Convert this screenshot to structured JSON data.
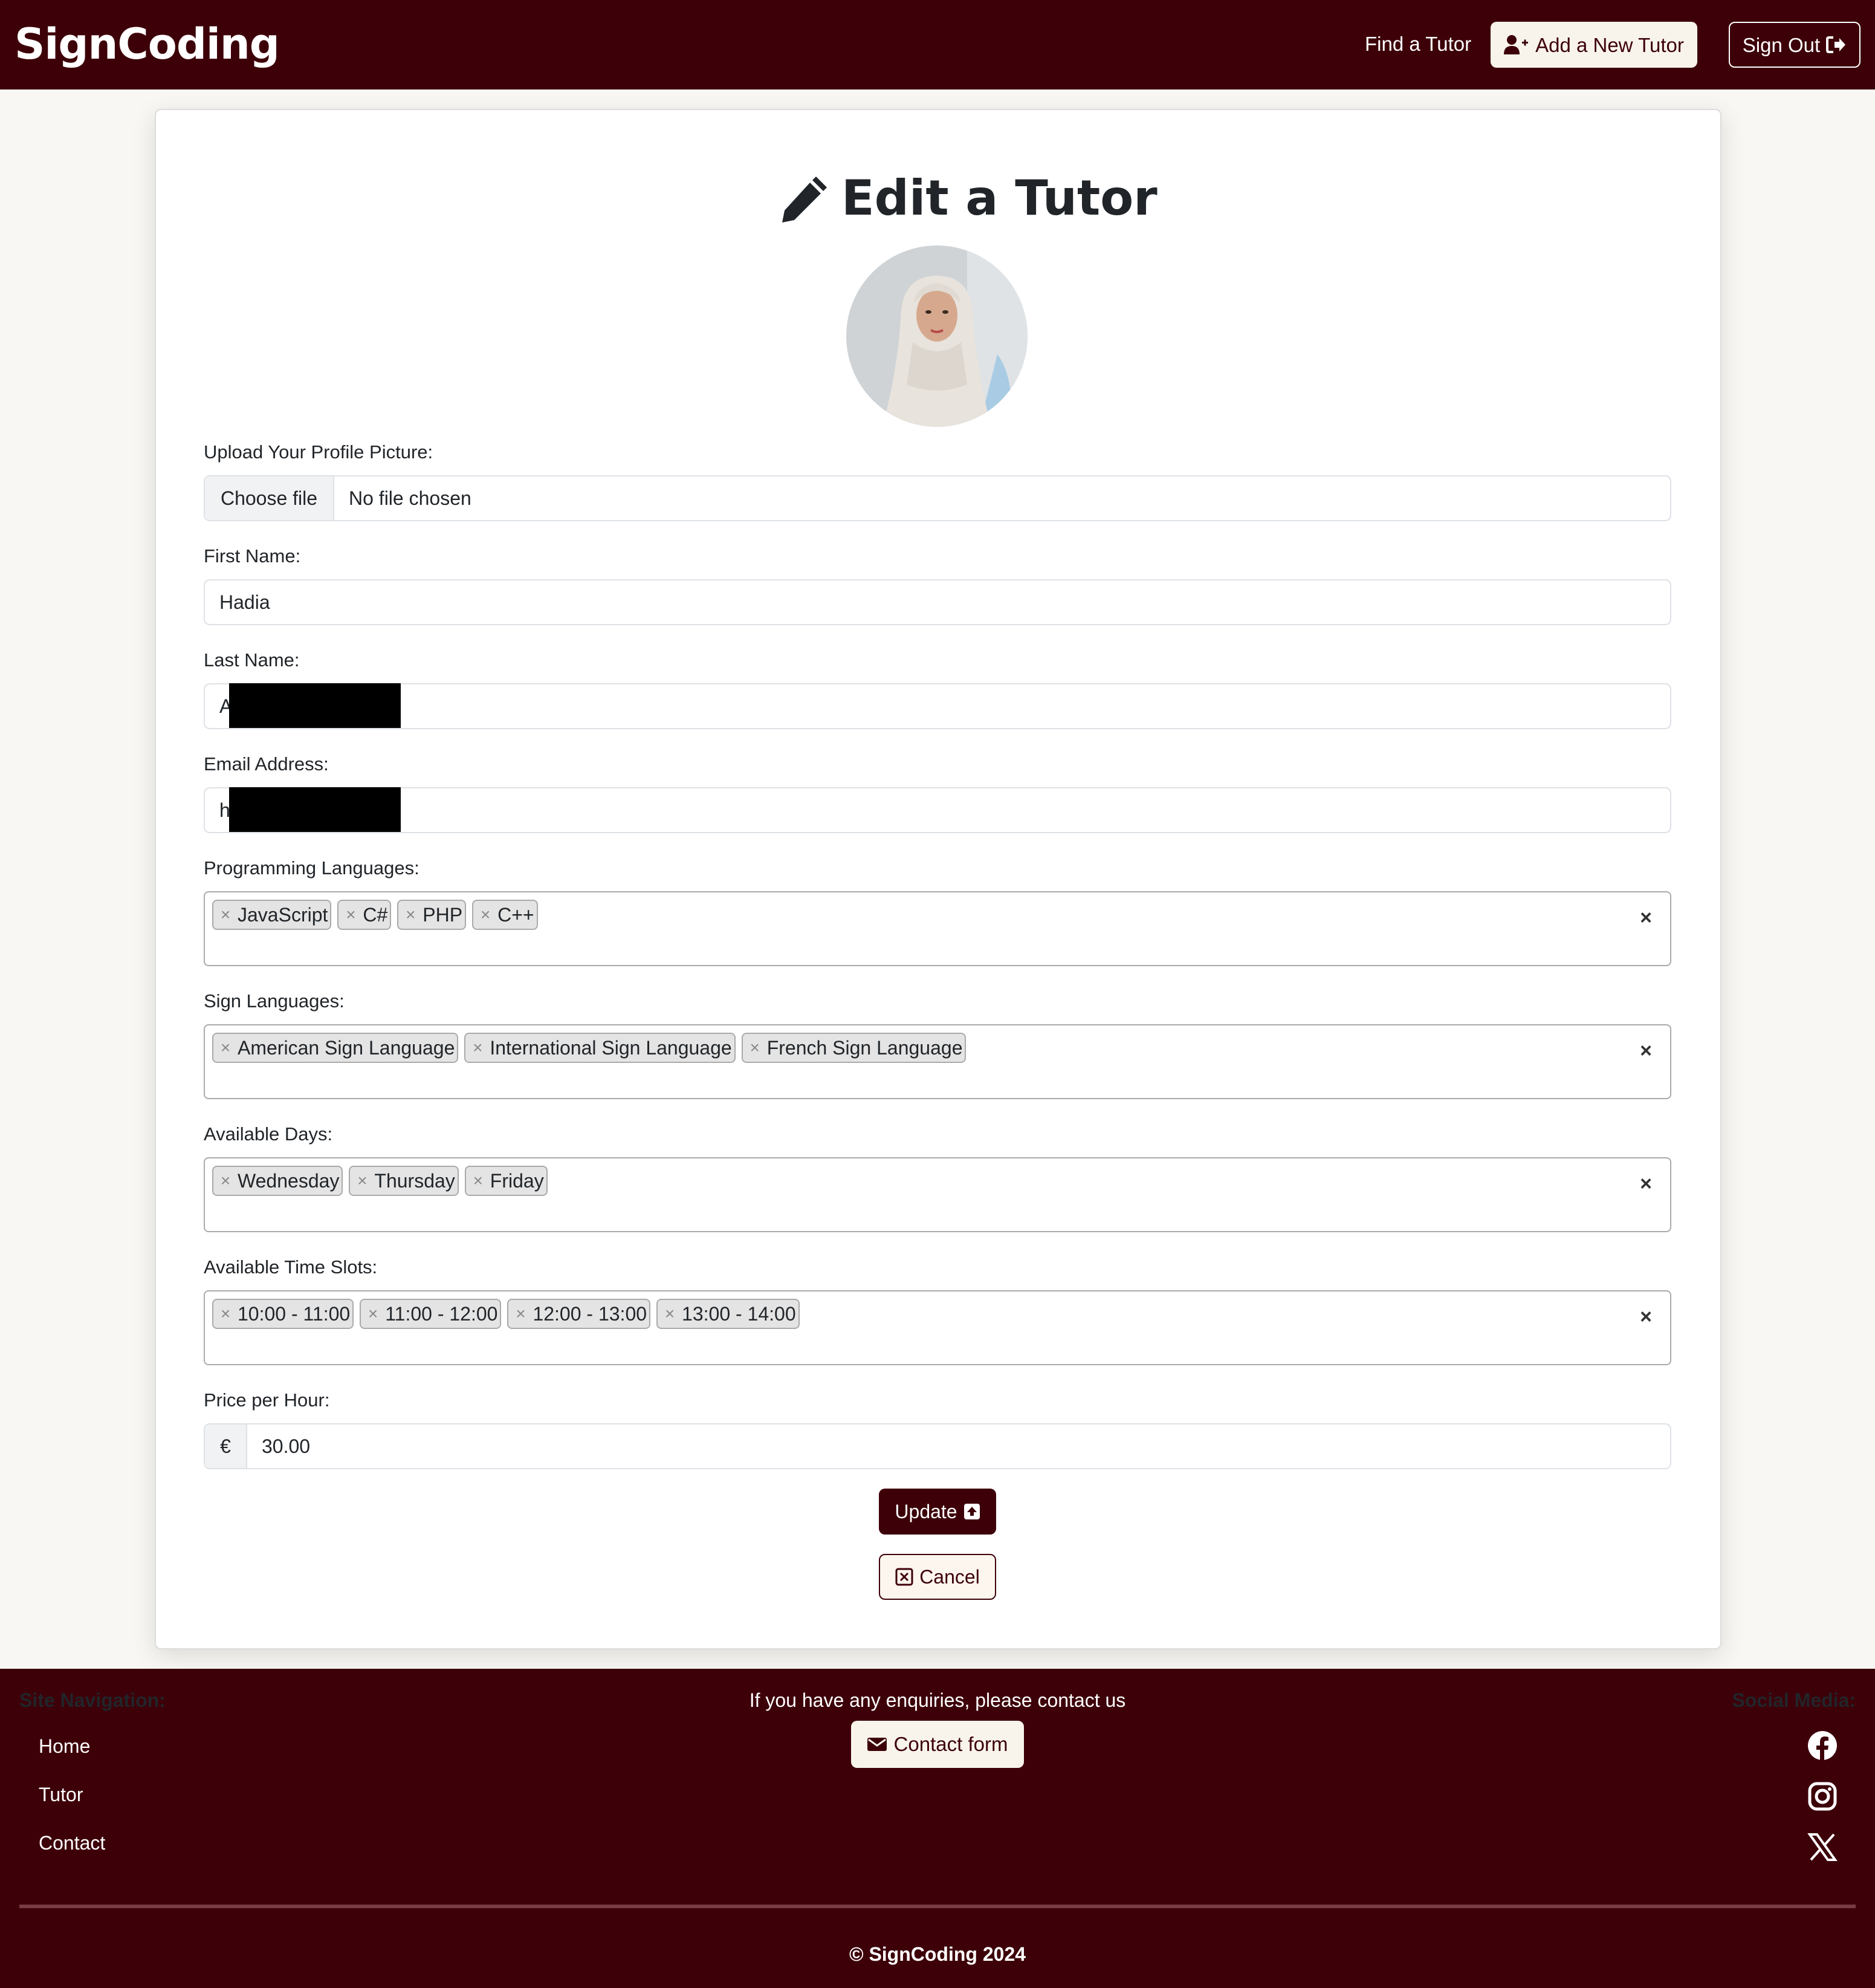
{
  "navbar": {
    "brand": "SignCoding",
    "find_tutor": "Find a Tutor",
    "add_tutor": "Add a New Tutor",
    "sign_out": "Sign Out"
  },
  "form": {
    "title": "Edit a Tutor",
    "upload_label": "Upload Your Profile Picture:",
    "choose_file": "Choose file",
    "no_file": "No file chosen",
    "first_name_label": "First Name:",
    "first_name_value": "Hadia",
    "last_name_label": "Last Name:",
    "last_name_visible": "A",
    "email_label": "Email Address:",
    "email_visible": "h",
    "prog_label": "Programming Languages:",
    "prog_tags": [
      "JavaScript",
      "C#",
      "PHP",
      "C++"
    ],
    "sign_label": "Sign Languages:",
    "sign_tags": [
      "American Sign Language",
      "International Sign Language",
      "French Sign Language"
    ],
    "days_label": "Available Days:",
    "day_tags": [
      "Wednesday",
      "Thursday",
      "Friday"
    ],
    "slots_label": "Available Time Slots:",
    "slot_tags": [
      "10:00 - 11:00",
      "11:00 - 12:00",
      "12:00 - 13:00",
      "13:00 - 14:00"
    ],
    "price_label": "Price per Hour:",
    "currency": "€",
    "price_value": "30.00",
    "update": "Update",
    "cancel": "Cancel",
    "tag_remove": "×",
    "clear_all": "×"
  },
  "footer": {
    "nav_heading": "Site Navigation:",
    "nav_links": [
      "Home",
      "Tutor",
      "Contact"
    ],
    "enquiry_text": "If you have any enquiries, please contact us",
    "contact_button": "Contact form",
    "social_heading": "Social Media:",
    "social_icons": [
      "facebook-icon",
      "instagram-icon",
      "x-icon"
    ],
    "copyright": "© SignCoding 2024"
  },
  "colors": {
    "brand": "#3d0009",
    "page_bg": "#f8f7f3",
    "light_button": "#f8f4ec"
  }
}
